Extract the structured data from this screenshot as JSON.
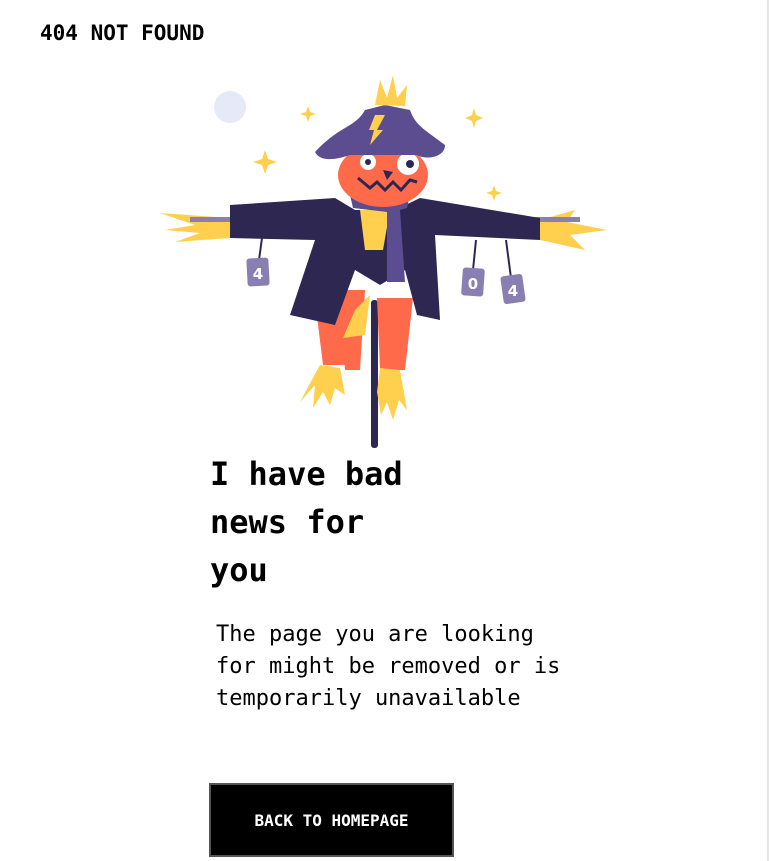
{
  "header": {
    "label": "404 NOT FOUND"
  },
  "illustration": {
    "description_icon": "scarecrow-illustration",
    "can_labels": [
      "4",
      "0",
      "4"
    ]
  },
  "main": {
    "headline": "I have bad news for you",
    "message": "The page you are looking for might be removed or is temporarily unavailable",
    "button_label": "BACK TO HOMEPAGE"
  },
  "colors": {
    "background": "#ffffff",
    "text": "#000000",
    "button_bg": "#000000",
    "button_text": "#ffffff",
    "hat": "#5b4d8f",
    "head": "#ff6b4a",
    "coat": "#2d2752",
    "straw": "#ffcf4d",
    "can": "#8a7fb3",
    "moon": "#e6e9f7"
  }
}
